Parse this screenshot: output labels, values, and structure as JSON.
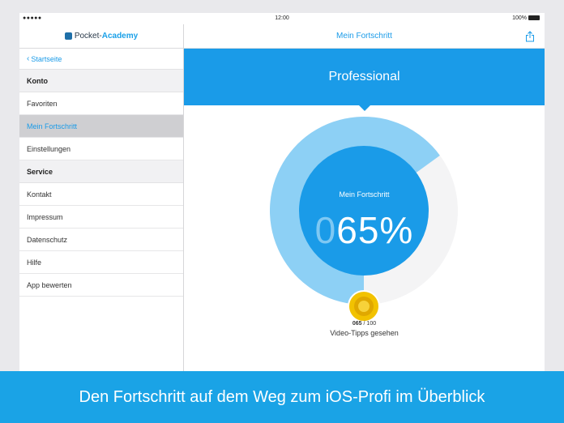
{
  "status": {
    "signal": "●●●●● ",
    "time": "12:00",
    "battery": "100%"
  },
  "sidebar": {
    "logo_a": "Pocket-",
    "logo_b": "Academy",
    "back_label": "Startseite",
    "sections": [
      {
        "title": "Konto",
        "items": [
          "Favoriten",
          "Mein Fortschritt",
          "Einstellungen"
        ]
      },
      {
        "title": "Service",
        "items": [
          "Kontakt",
          "Impressum",
          "Datenschutz",
          "Hilfe",
          "App bewerten"
        ]
      }
    ],
    "active_item": "Mein Fortschritt"
  },
  "nav": {
    "title": "Mein Fortschritt"
  },
  "banner": {
    "title": "Professional"
  },
  "progress": {
    "label": "Mein Fortschritt",
    "percent_lead": "0",
    "percent_value": "65%",
    "fraction": 0.65,
    "count_done": "065",
    "count_total": "/ 100",
    "caption": "Video-Tipps gesehen"
  },
  "colors": {
    "accent": "#1a9be8",
    "gauge_light": "#8dd0f5",
    "coin": "#f2c200"
  },
  "promo": {
    "text": "Den Fortschritt auf dem Weg zum iOS-Profi im Überblick"
  }
}
